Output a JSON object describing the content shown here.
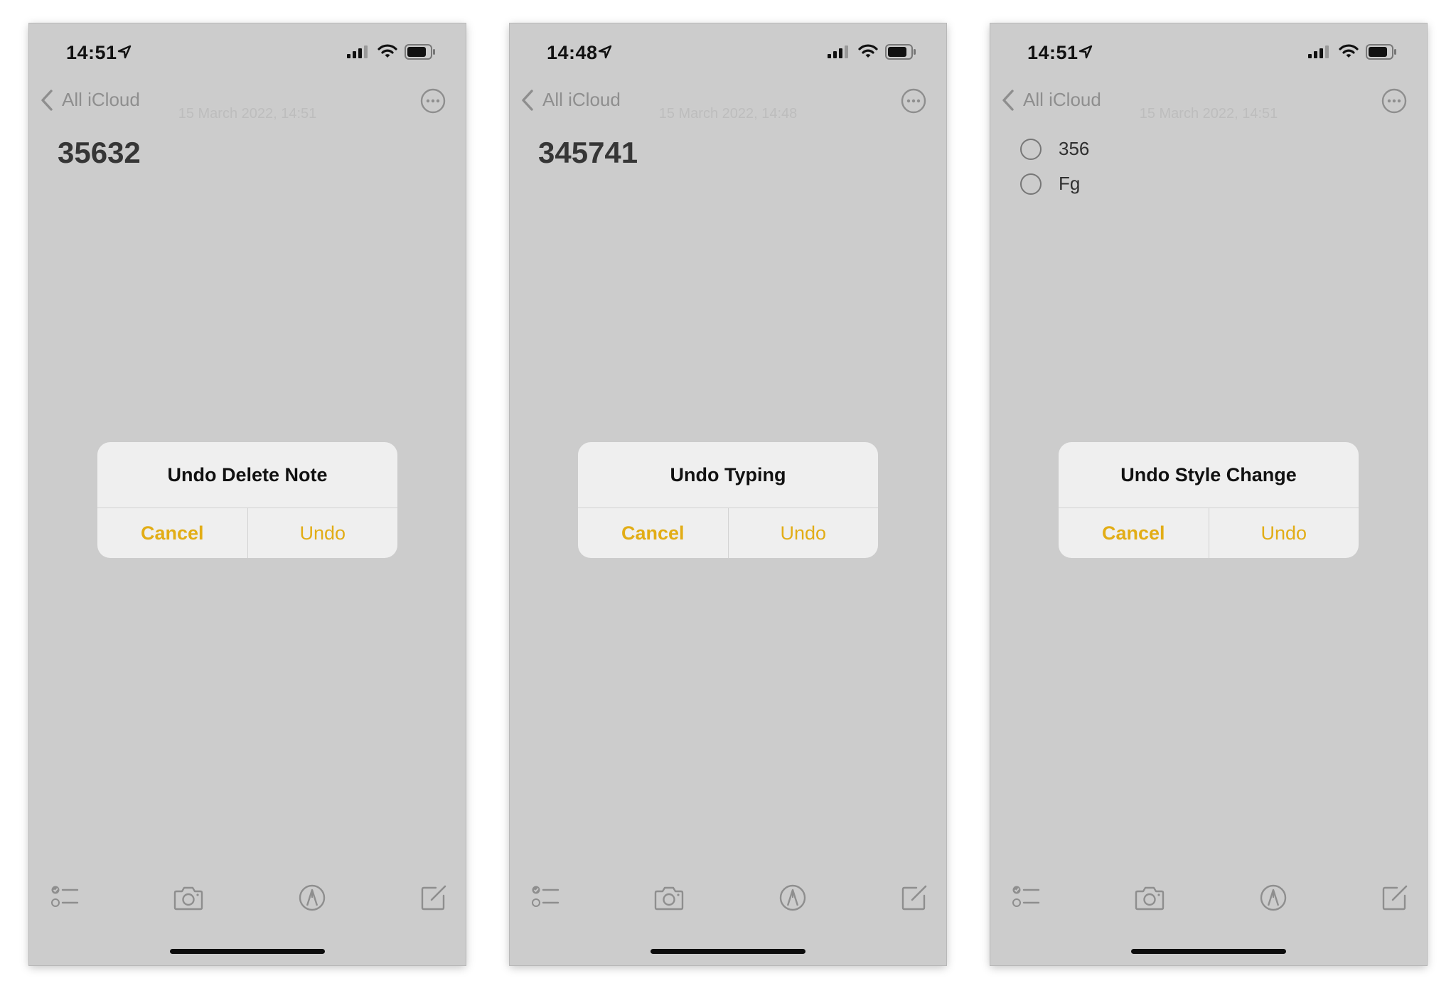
{
  "screens": [
    {
      "status_time": "14:51",
      "back_label": "All iCloud",
      "date_ghost": "15 March 2022, 14:51",
      "note_title": "35632",
      "checklist": [],
      "dialog": {
        "title": "Undo Delete Note",
        "cancel": "Cancel",
        "undo": "Undo"
      }
    },
    {
      "status_time": "14:48",
      "back_label": "All iCloud",
      "date_ghost": "15 March 2022, 14:48",
      "note_title": "345741",
      "checklist": [],
      "dialog": {
        "title": "Undo Typing",
        "cancel": "Cancel",
        "undo": "Undo"
      }
    },
    {
      "status_time": "14:51",
      "back_label": "All iCloud",
      "date_ghost": "15 March 2022, 14:51",
      "note_title": "",
      "checklist": [
        "356",
        "Fg"
      ],
      "dialog": {
        "title": "Undo Style Change",
        "cancel": "Cancel",
        "undo": "Undo"
      }
    }
  ],
  "icons": {
    "location": "location-arrow-icon",
    "signal": "cellular-signal-icon",
    "wifi": "wifi-icon",
    "battery": "battery-icon",
    "back": "chevron-left-icon",
    "more": "ellipsis-circle-icon",
    "checklist": "checklist-icon",
    "camera": "camera-icon",
    "markup": "markup-pen-icon",
    "compose": "compose-icon"
  },
  "colors": {
    "accent": "#e2ad16",
    "dim_background": "#cccccc",
    "dialog_background": "#efefef"
  }
}
